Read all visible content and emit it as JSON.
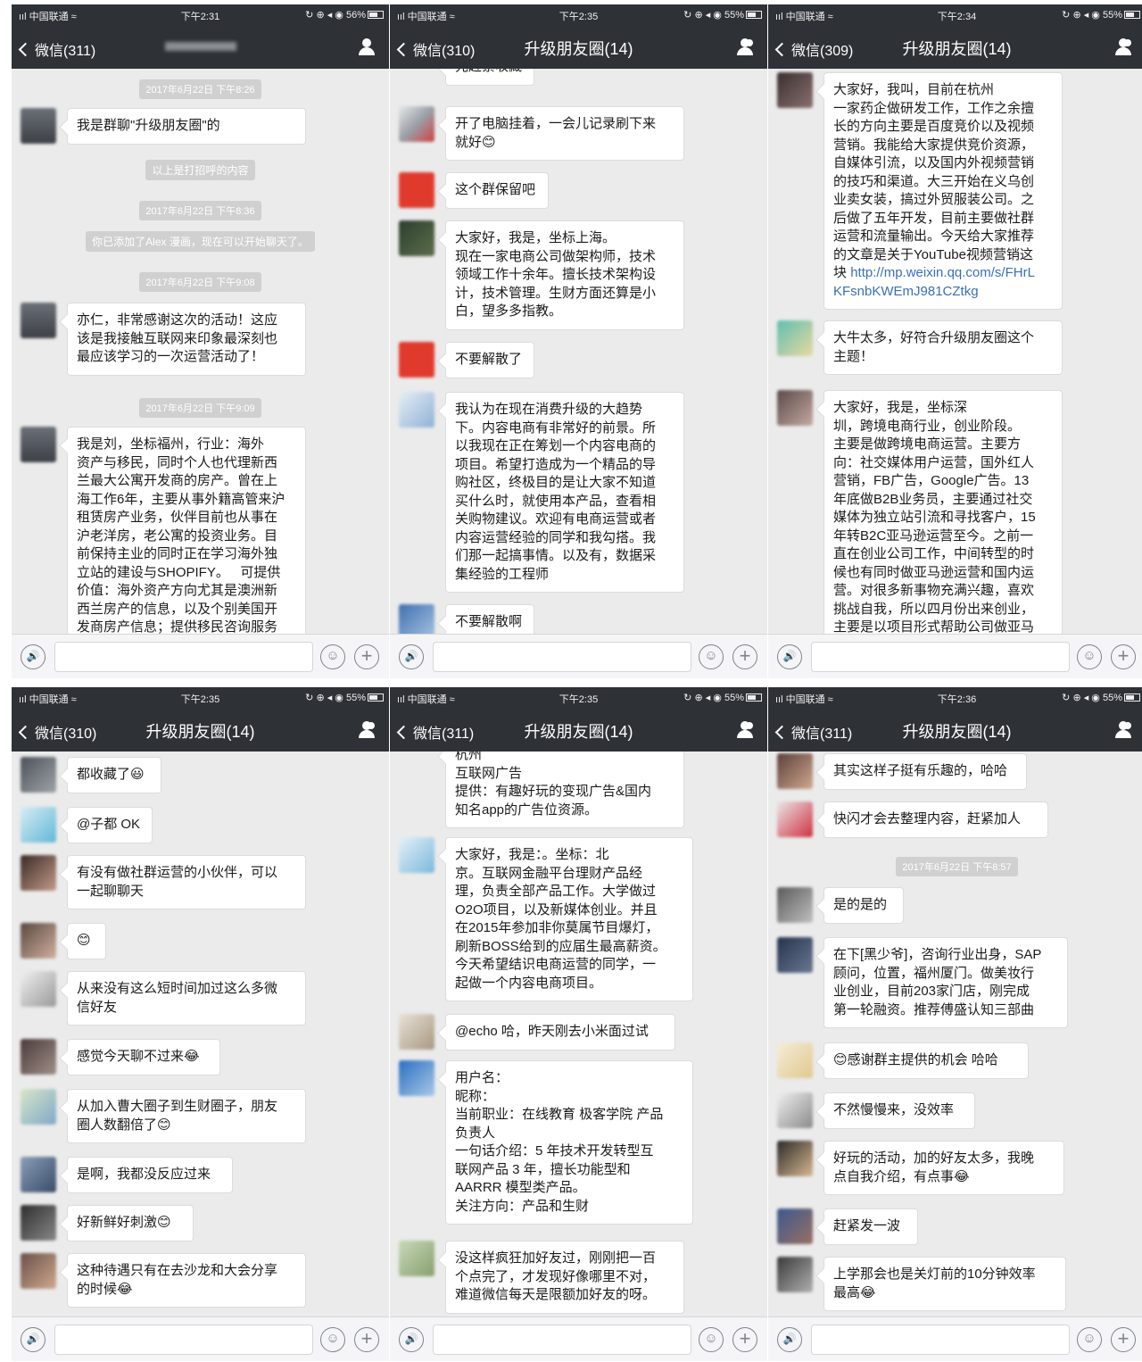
{
  "status": {
    "carrier": "ııl 中国联通 ≈",
    "icons": "↻ ⊕ ◂ ◉",
    "panels": [
      {
        "time": "下午2:31",
        "battery": "56%"
      },
      {
        "time": "下午2:35",
        "battery": "55%"
      },
      {
        "time": "下午2:34",
        "battery": "55%"
      },
      {
        "time": "下午2:35",
        "battery": "55%"
      },
      {
        "time": "下午2:35",
        "battery": "55%"
      },
      {
        "time": "下午2:36",
        "battery": "55%"
      }
    ]
  },
  "nav": {
    "group_title": "升级朋友圈(14)",
    "panels": [
      {
        "back": "微信(311)"
      },
      {
        "back": "微信(310)"
      },
      {
        "back": "微信(309)"
      },
      {
        "back": "微信(310)"
      },
      {
        "back": "微信(311)"
      },
      {
        "back": "微信(311)"
      }
    ]
  },
  "icons": {
    "voice": "🔊",
    "emoji": "☺",
    "plus": "+"
  },
  "panel1": {
    "items": [
      "2017年6月22日 下午8:26",
      "我是群聊\"升级朋友圈\"的",
      "以上是打招呼的内容",
      "2017年6月22日 下午8:36",
      "你已添加了Alex 漫画，现在可以开始聊天了。",
      "2017年6月22日 下午9:08",
      "亦仁，非常感谢这次的活动！这应\n该是我接触互联网来印象最深刻也\n最应该学习的一次运营活动了！",
      "2017年6月22日 下午9:09",
      "我是刘，坐标福州，行业：海外\n资产与移民，同时个人也代理新西\n兰最大公寓开发商的房产。曾在上\n海工作6年，主要从事外籍高管来沪\n租赁房产业务，伙伴目前也从事在\n沪老洋房，老公寓的投资业务。目\n前保持主业的同时正在学习海外独\n立站的建设与SHOPIFY。   可提供\n价值：海外资产方向尤其是澳洲新\n西兰房产的信息，以及个别美国开\n发商房产信息；提供移民咨询服务"
    ]
  },
  "panel2": {
    "items": [
      "先赶紧收藏",
      "开了电脑挂着，一会儿记录刷下来\n就好😊",
      "这个群保留吧",
      "大家好，我是，坐标上海。\n现在一家电商公司做架构师，技术\n领域工作十余年。擅长技术架构设\n计，技术管理。生财方面还算是小\n白，望多多指教。",
      "不要解散了",
      "我认为在现在消费升级的大趋势\n下。内容电商有非常好的前景。所\n以我现在正在筹划一个内容电商的\n项目。希望打造成为一个精品的导\n购社区，终极目的是让大家不知道\n买什么时，就使用本产品，查看相\n关购物建议。欢迎有电商运营或者\n内容运营经验的同学和我勾搭。我\n们那一起搞事情。以及有，数据采\n集经验的工程师",
      "不要解散啊"
    ]
  },
  "panel3": {
    "items": [
      "大家好，我叫，目前在杭州\n一家药企做研发工作，工作之余擅\n长的方向主要是百度竞价以及视频\n营销。我能给大家提供竞价资源，\n自媒体引流，以及国内外视频营销\n的技巧和渠道。大三开始在义乌创\n业卖女装，搞过外贸服装公司。之\n后做了五年开发，目前主要做社群\n运营和流量输出。今天给大家推荐\n的文章是关于YouTube视频营销这\n块",
      "http://mp.weixin.qq.com/s/FHrL\nKFsnbKWEmJ981CZtkg",
      "大牛太多，好符合升级朋友圈这个\n主题！",
      "大家好，我是，坐标深\n圳，跨境电商行业，创业阶段。\n主要是做跨境电商运营。主要方\n向：社交媒体用户运营，国外红人\n营销，FB广告，Google广告。13\n年底做B2B业务员，主要通过社交\n媒体为独立站引流和寻找客户，15\n年转B2C亚马逊运营至今。之前一\n直在创业公司工作，中间转型的时\n候也有同时做亚马逊运营和国内运\n营。对很多新事物充满兴趣，喜欢\n挑战自我，所以四月份出来创业，\n主要是以项目形式帮助公司做亚马"
    ]
  },
  "panel4": {
    "items": [
      "都收藏了😃",
      "@子都 OK",
      "有没有做社群运营的小伙伴，可以\n一起聊聊天",
      "😊",
      "从来没有这么短时间加过这么多微\n信好友",
      "感觉今天聊不过来😂",
      "从加入曹大圈子到生财圈子，朋友\n圈人数翻倍了😊",
      "是啊，我都没反应过来",
      "好新鲜好刺激😊",
      "这种待遇只有在去沙龙和大会分享\n的时候😂"
    ]
  },
  "panel5": {
    "items": [
      "杭州\n互联网广告\n提供：有趣好玩的变现广告&国内\n知名app的广告位资源。",
      "大家好，我是：。坐标：北\n京。互联网金融平台理财产品经\n理，负责全部产品工作。大学做过\nO2O项目，以及新媒体创业。并且\n在2015年参加非你莫属节目爆灯，\n刷新BOSS给到的应届生最高薪资。\n今天希望结识电商运营的同学，一\n起做一个内容电商项目。",
      "@echo 哈，昨天刚去小米面过试",
      "用户名：\n昵称：\n当前职业：在线教育 极客学院 产品\n负责人\n一句话介绍：5 年技术开发转型互\n联网产品 3 年，擅长功能型和\nAARRR 模型类产品。\n关注方向：产品和生财",
      "没这样疯狂加好友过，刚刚把一百\n个点完了，才发现好像哪里不对，\n难道微信每天是限额加好友的呀。"
    ]
  },
  "panel6": {
    "items": [
      "其实这样子挺有乐趣的，哈哈",
      "快闪才会去整理内容，赶紧加人",
      "2017年6月22日 下午8:57",
      "是的是的",
      "在下[黑少爷]，咨询行业出身，SAP\n顾问，位置，福州厦门。做美妆行\n业创业，目前203家门店，刚完成\n第一轮融资。推荐傅盛认知三部曲",
      "😊感谢群主提供的机会 哈哈",
      "不然慢慢来，没效率",
      "好玩的活动，加的好友太多，我晚\n点自我介绍，有点事😂",
      "赶紧发一波",
      "上学那会也是关灯前的10分钟效率\n最高😂"
    ]
  }
}
